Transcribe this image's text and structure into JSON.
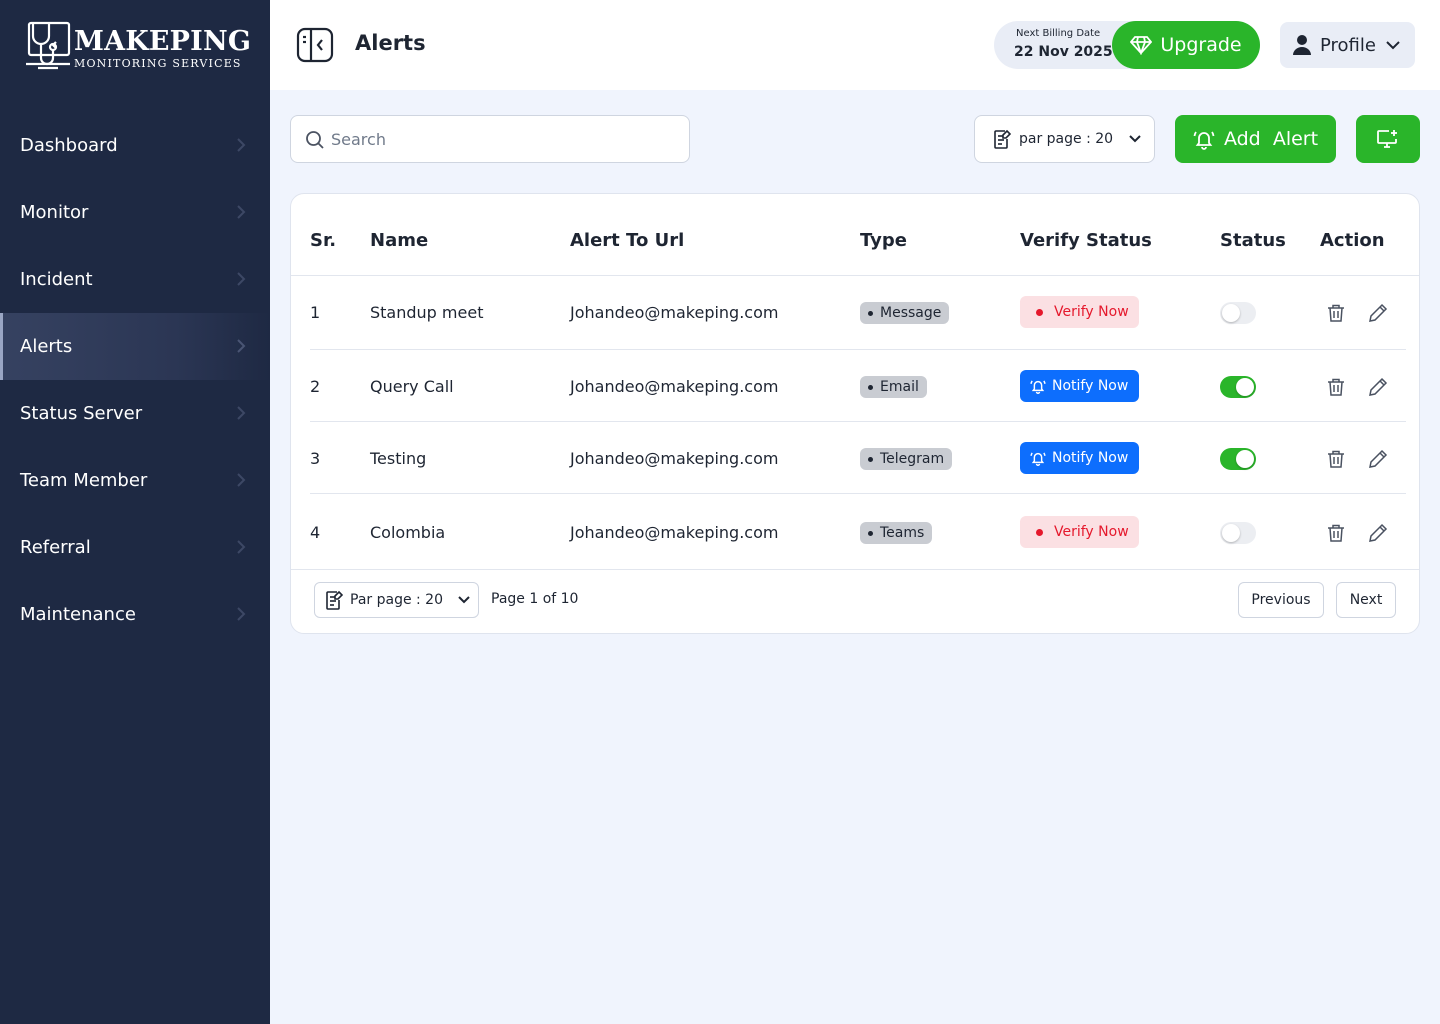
{
  "brand": {
    "name": "MAKEPING",
    "tagline": "MONITORING SERVICES"
  },
  "sidebar": {
    "items": [
      {
        "label": "Dashboard",
        "active": false
      },
      {
        "label": "Monitor",
        "active": false
      },
      {
        "label": "Incident",
        "active": false
      },
      {
        "label": "Alerts",
        "active": true
      },
      {
        "label": "Status Server",
        "active": false
      },
      {
        "label": "Team Member",
        "active": false
      },
      {
        "label": "Referral",
        "active": false
      },
      {
        "label": "Maintenance",
        "active": false
      }
    ]
  },
  "header": {
    "title": "Alerts",
    "billing_label": "Next Billing Date",
    "billing_date": "22 Nov 2025",
    "upgrade_label": "Upgrade",
    "profile_label": "Profile"
  },
  "toolbar": {
    "search_placeholder": "Search",
    "per_page_label": "par page : 20",
    "add_alert_label": "Add  Alert"
  },
  "table": {
    "columns": [
      "Sr.",
      "Name",
      "Alert To Url",
      "Type",
      "Verify Status",
      "Status",
      "Action"
    ],
    "rows": [
      {
        "sr": "1",
        "name": "Standup meet",
        "url": "Johandeo@makeping.com",
        "type": "Message",
        "verify": "Verify Now",
        "verify_state": "unverified",
        "status_on": false
      },
      {
        "sr": "2",
        "name": "Query Call",
        "url": "Johandeo@makeping.com",
        "type": "Email",
        "verify": "Notify Now",
        "verify_state": "verified",
        "status_on": true
      },
      {
        "sr": "3",
        "name": "Testing",
        "url": "Johandeo@makeping.com",
        "type": "Telegram",
        "verify": "Notify Now",
        "verify_state": "verified",
        "status_on": true
      },
      {
        "sr": "4",
        "name": "Colombia",
        "url": "Johandeo@makeping.com",
        "type": "Teams",
        "verify": "Verify Now",
        "verify_state": "unverified",
        "status_on": false
      }
    ]
  },
  "pagination": {
    "per_page_label": "Par page : 20",
    "page_info": "Page 1 of 10",
    "previous_label": "Previous",
    "next_label": "Next"
  },
  "colors": {
    "sidebar_bg": "#1e2943",
    "accent_green": "#2ab52a",
    "notify_blue": "#0d6efd",
    "verify_red": "#e5182c",
    "page_bg": "#f0f4fd"
  }
}
